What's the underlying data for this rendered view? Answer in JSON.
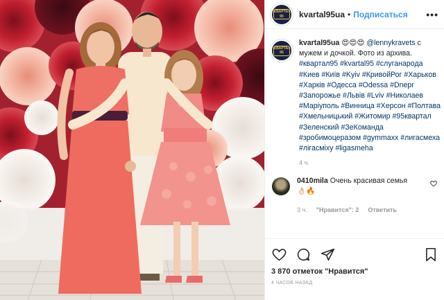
{
  "post": {
    "username": "kvartal95ua",
    "follow_label": "Подписаться",
    "separator": "•",
    "more_label": "•••",
    "avatar_text": "КВАРТАЛ 95"
  },
  "caption": {
    "username": "kvartal95ua",
    "body_prefix": " 😍😍😍 ",
    "mention": "@lennykravets",
    "body_text": " с мужем и дочкой. Фото из архива.",
    "hashtags": [
      "#квартал95",
      "#kvartal95",
      "#слуганарода",
      "#Киев",
      "#Київ",
      "#Kyiv",
      "#КривойРог",
      "#Харьков",
      "#Харків",
      "#Одесса",
      "#Odessa",
      "#Dnepr",
      "#Запорожье",
      "#Львів",
      "#Lviv",
      "#Николаев",
      "#Маріуполь",
      "#Винница",
      "#Херсон",
      "#Полтава",
      "#Хмельницький",
      "#Житомир",
      "#95квартал",
      "#Зеленский",
      "#ЗеКоманда",
      "#зробимоцеразом",
      "#gymmaxx",
      "#лигасмеха",
      "#лігасміху",
      "#ligasmeha"
    ],
    "time_ago": "4 ч."
  },
  "comment": {
    "username": "0410mila",
    "text": " Очень красивая семья",
    "emoji": "👌🏻🔥",
    "time_ago": "3 ч.",
    "likes_label": "\"Нравится\": 2",
    "reply_label": "Ответить"
  },
  "footer": {
    "likes_text": "3 870 отметок \"Нравится\"",
    "timestamp": "4 ЧАСОВ НАЗАД"
  },
  "colors": {
    "link": "#3897f0",
    "hashtag": "#003569",
    "muted": "#999999",
    "brand_navy": "#16204a"
  }
}
